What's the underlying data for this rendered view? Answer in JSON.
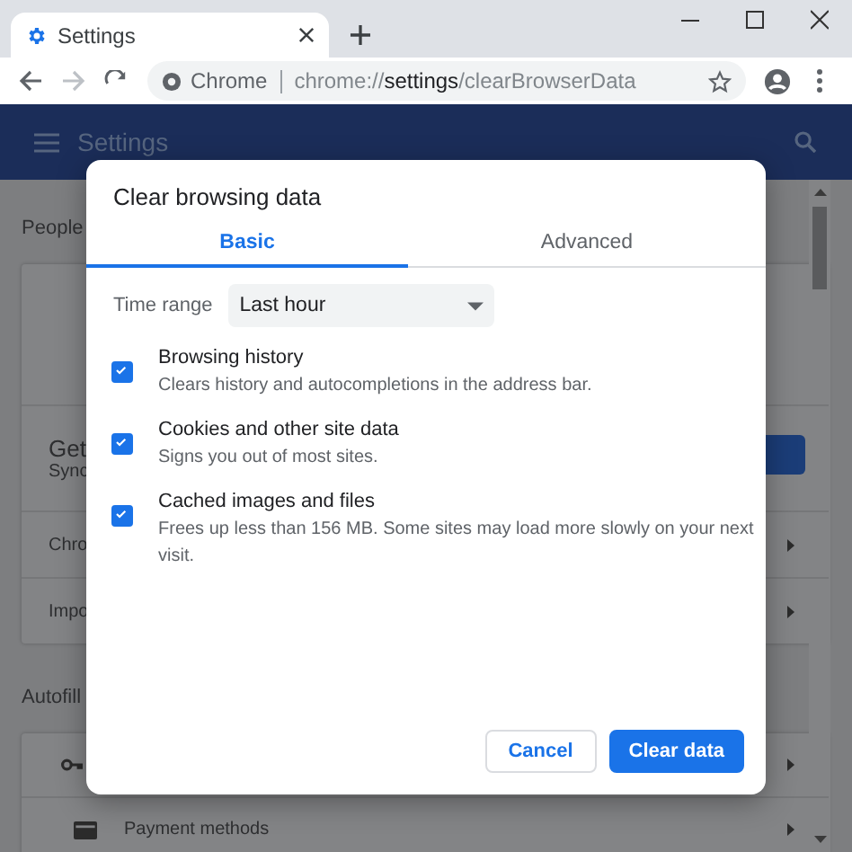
{
  "browser_tab": {
    "title": "Settings",
    "selected": true
  },
  "toolbar": {
    "site_label": "Chrome",
    "url": "chrome://**settings**/clearBrowserData"
  },
  "header": {
    "title": "Settings"
  },
  "page": {
    "people": {
      "title": "People",
      "sign_in_title": "Get",
      "sign_in_subtitle": "Sync",
      "rows": [
        "Chro",
        "Impo"
      ]
    },
    "autofill": {
      "title": "Autofill",
      "payment_row": "Payment methods"
    }
  },
  "dialog": {
    "title": "Clear browsing data",
    "tabs": [
      {
        "label": "Basic",
        "selected": true
      },
      {
        "label": "Advanced",
        "selected": false
      }
    ],
    "time_range": {
      "label": "Time range",
      "value": "Last hour"
    },
    "options": [
      {
        "title": "Browsing history",
        "description": "Clears history and autocompletions in the address bar.",
        "checked": true
      },
      {
        "title": "Cookies and other site data",
        "description": "Signs you out of most sites.",
        "checked": true
      },
      {
        "title": "Cached images and files",
        "description": "Frees up less than 156 MB. Some sites may load more slowly on your next visit.",
        "checked": true
      }
    ],
    "buttons": [
      {
        "label": "Cancel",
        "kind": "secondary"
      },
      {
        "label": "Clear data",
        "kind": "primary"
      }
    ]
  }
}
